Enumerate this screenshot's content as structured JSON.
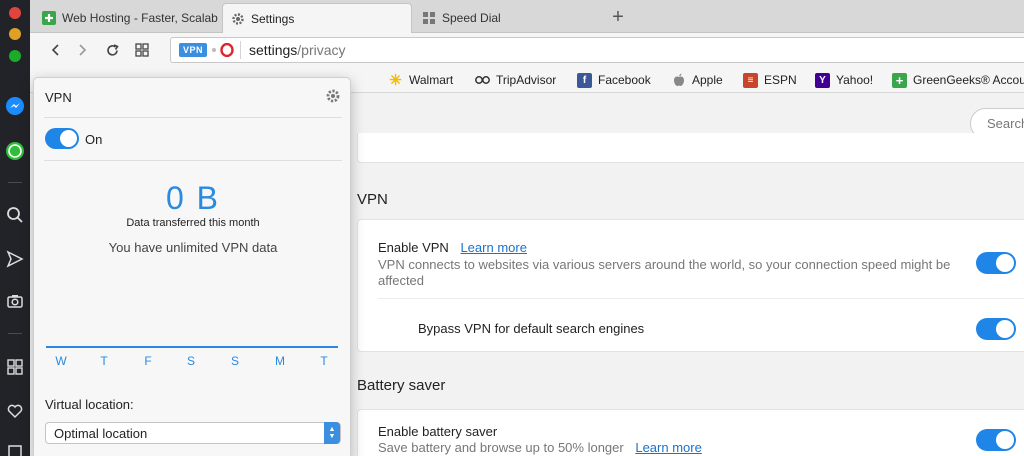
{
  "tabs": [
    {
      "label": "Web Hosting - Faster, Scalab",
      "icon": "greengeeks-icon",
      "active": false
    },
    {
      "label": "Settings",
      "icon": "gear-icon",
      "active": true
    },
    {
      "label": "Speed Dial",
      "icon": "grid-icon",
      "active": false
    }
  ],
  "newtab_label": "+",
  "address": {
    "vpn_badge": "VPN",
    "url_host": "settings",
    "url_path": "/privacy"
  },
  "bookmarks": [
    {
      "label": "Walmart",
      "icon": "walmart-icon",
      "color": "#f7b900"
    },
    {
      "label": "TripAdvisor",
      "icon": "tripadvisor-icon",
      "color": "#333333"
    },
    {
      "label": "Facebook",
      "icon": "facebook-icon",
      "color": "#3b5998"
    },
    {
      "label": "Apple",
      "icon": "apple-icon",
      "color": "#888888"
    },
    {
      "label": "ESPN",
      "icon": "espn-icon",
      "color": "#c8452b"
    },
    {
      "label": "Yahoo!",
      "icon": "yahoo-icon",
      "color": "#410093"
    },
    {
      "label": "GreenGeeks® Accour",
      "icon": "greengeeks-icon",
      "color": "#3aa54b"
    }
  ],
  "search": {
    "placeholder": "Search"
  },
  "sections": {
    "vpn": {
      "title": "VPN",
      "enable_label": "Enable VPN",
      "learn_more": "Learn more",
      "description": "VPN connects to websites via various servers around the world, so your connection speed might be affected",
      "bypass_label": "Bypass VPN for default search engines"
    },
    "battery": {
      "title": "Battery saver",
      "enable_label": "Enable battery saver",
      "description": "Save battery and browse up to 50% longer",
      "learn_more": "Learn more"
    }
  },
  "vpn_popup": {
    "title": "VPN",
    "toggle_label": "On",
    "data_value": "0 B",
    "data_label": "Data transferred this month",
    "unlimited_text": "You have unlimited VPN data",
    "days": [
      "W",
      "T",
      "F",
      "S",
      "S",
      "M",
      "T"
    ],
    "location_label": "Virtual location:",
    "location_value": "Optimal location"
  },
  "colors": {
    "accent": "#1f86e8",
    "sidebar": "#222328"
  }
}
